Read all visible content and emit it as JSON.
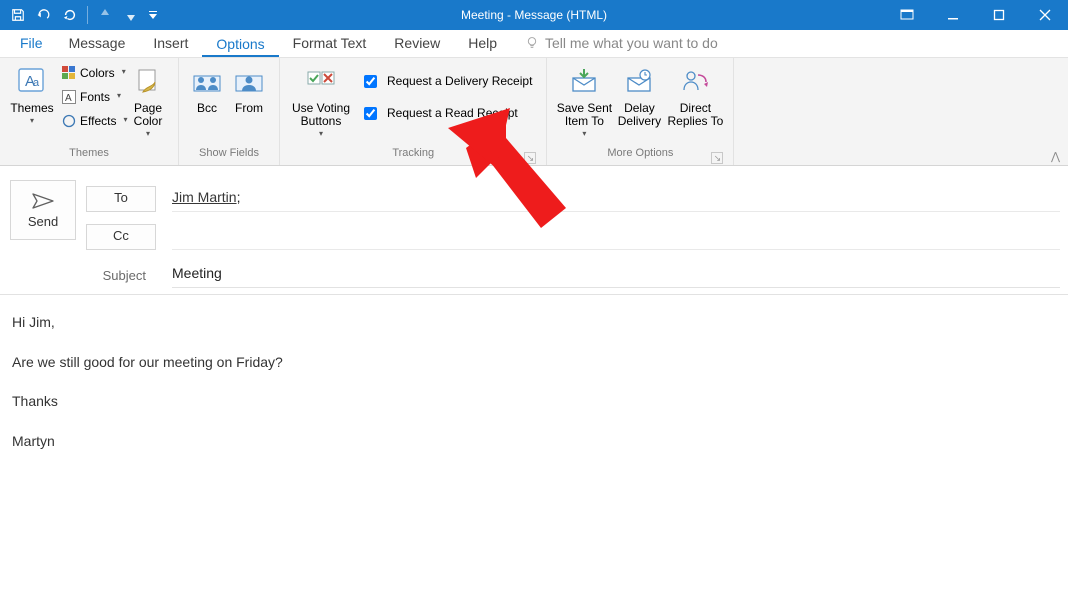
{
  "window": {
    "title": "Meeting  -  Message (HTML)"
  },
  "tabs": {
    "file": "File",
    "message": "Message",
    "insert": "Insert",
    "options": "Options",
    "format_text": "Format Text",
    "review": "Review",
    "help": "Help",
    "tell_me": "Tell me what you want to do"
  },
  "ribbon": {
    "themes": {
      "label": "Themes",
      "themes_btn": "Themes",
      "colors": "Colors",
      "fonts": "Fonts",
      "effects": "Effects",
      "page_color": "Page\nColor"
    },
    "show_fields": {
      "label": "Show Fields",
      "bcc": "Bcc",
      "from": "From"
    },
    "tracking": {
      "label": "Tracking",
      "voting": "Use Voting\nButtons",
      "delivery_receipt": "Request a Delivery Receipt",
      "read_receipt": "Request a Read Receipt"
    },
    "more_options": {
      "label": "More Options",
      "save_sent": "Save Sent\nItem To",
      "delay": "Delay\nDelivery",
      "direct": "Direct\nReplies To"
    }
  },
  "compose": {
    "send": "Send",
    "to_label": "To",
    "cc_label": "Cc",
    "subject_label": "Subject",
    "to_value": "Jim Martin",
    "subject_value": "Meeting"
  },
  "body": {
    "p1": "Hi Jim,",
    "p2": "Are we still good for our meeting on Friday?",
    "p3": "Thanks",
    "p4": "Martyn"
  }
}
